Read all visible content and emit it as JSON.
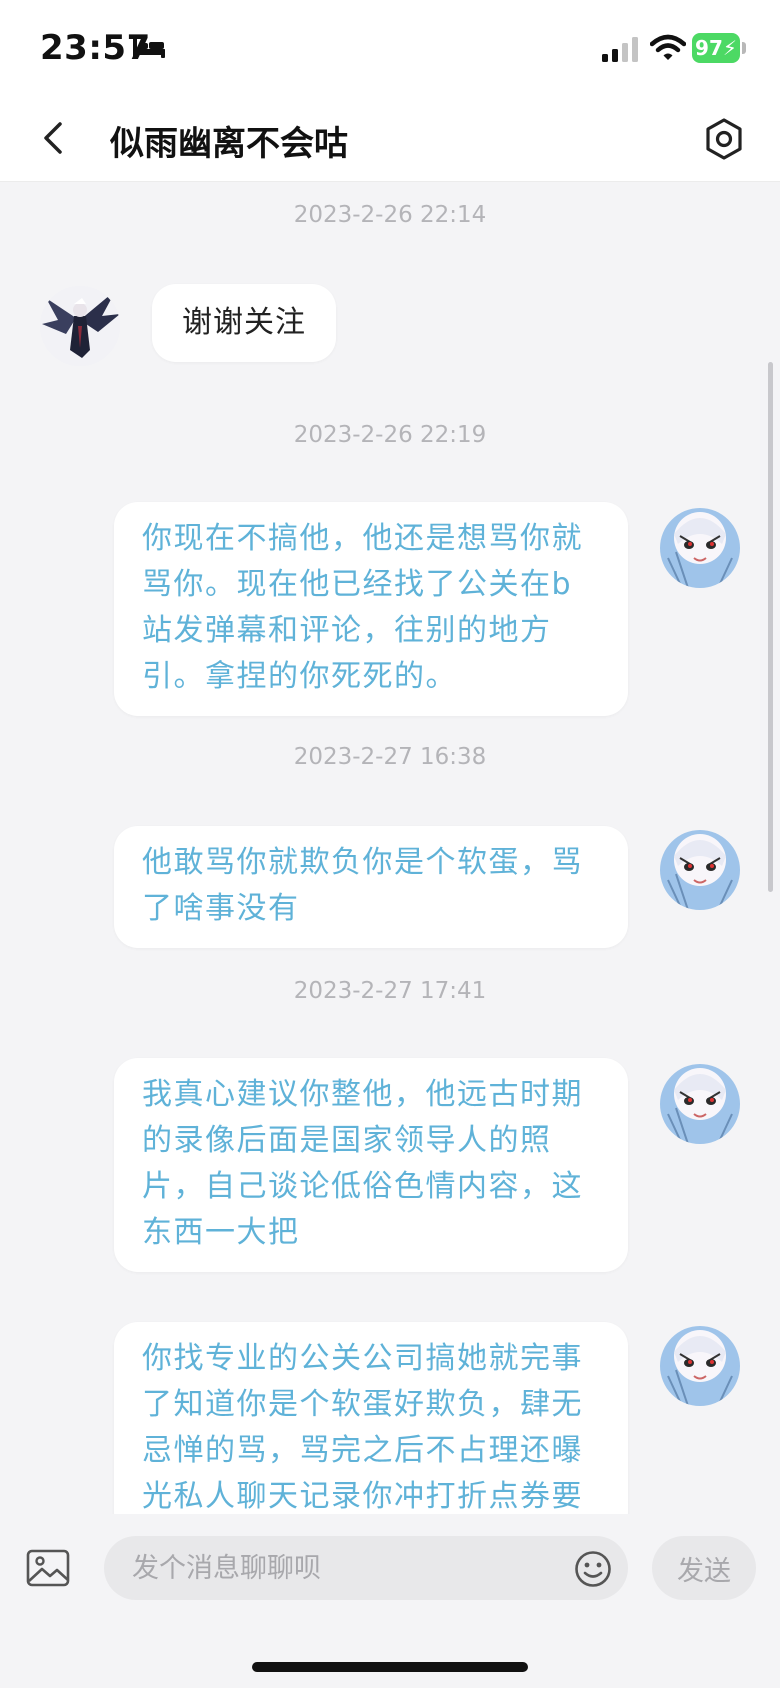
{
  "status_bar": {
    "time": "23:57",
    "battery": "97"
  },
  "header": {
    "title": "似雨幽离不会咕"
  },
  "messages": [
    {
      "timestamp": "2023-2-26 22:14",
      "side": "left",
      "text": "谢谢关注"
    },
    {
      "timestamp": "2023-2-26 22:19",
      "side": "right",
      "text": "你现在不搞他，他还是想骂你就骂你。现在他已经找了公关在b站发弹幕和评论，往别的地方引。拿捏的你死死的。"
    },
    {
      "timestamp": "2023-2-27 16:38",
      "side": "right",
      "text": "他敢骂你就欺负你是个软蛋，骂了啥事没有"
    },
    {
      "timestamp": "2023-2-27 17:41",
      "side": "right",
      "text": "我真心建议你整他，他远古时期的录像后面是国家领导人的照片，自己谈论低俗色情内容，这东西一大把"
    },
    {
      "timestamp": "",
      "side": "right",
      "text": "你找专业的公关公司搞她就完事了知道你是个软蛋好欺负，肆无忌惮的骂，骂完之后不占理还曝光私人聊天记录你冲打折点券要"
    }
  ],
  "input": {
    "placeholder": "发个消息聊聊呗",
    "send_label": "发送"
  },
  "icons": {
    "back": "chevron-left-icon",
    "settings": "hexagon-settings-icon",
    "image": "image-icon",
    "emoji": "emoji-icon"
  },
  "colors": {
    "message_text": "#5fb2d8",
    "background": "#f4f4f6",
    "battery": "#4cd964"
  }
}
